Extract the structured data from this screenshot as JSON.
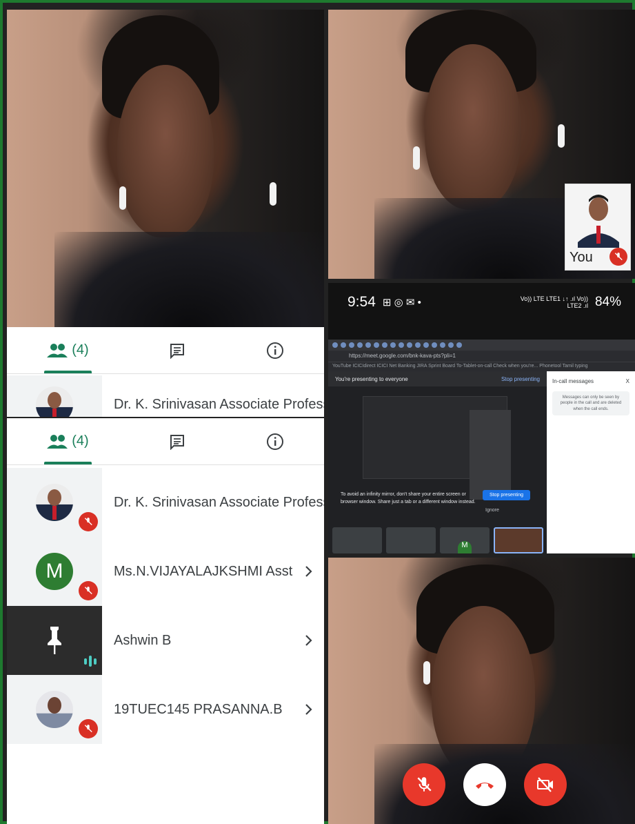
{
  "colors": {
    "frame_border": "#1e7a2f",
    "accent_green": "#1a7f5a",
    "mute_red": "#d93025",
    "control_red": "#e8382b",
    "avatar_green": "#2e7d32"
  },
  "participants_panel": {
    "people_tab_count": "(4)",
    "people_tab_icon": "people-icon",
    "chat_tab_icon": "chat-icon",
    "info_tab_icon": "info-icon"
  },
  "participants_preview": [
    {
      "name": "Dr. K. Srinivasan Associate Professo..."
    }
  ],
  "participants": [
    {
      "name": "Dr. K. Srinivasan Associate Professo...",
      "avatar": "photo",
      "muted": true
    },
    {
      "name": "Ms.N.VIJAYALAJKSHMI Asst P...",
      "avatar_letter": "M",
      "muted": true
    },
    {
      "name": "Ashwin B",
      "avatar": "pin",
      "speaking": true
    },
    {
      "name": "19TUEC145 PRASANNA.B",
      "avatar": "photo",
      "muted": true
    }
  ],
  "phone_screenshot": {
    "time": "9:54",
    "status_icons": "Vo)) LTE LTE1 ↓↑ .ıl Vo)) LTE2 .ıl",
    "battery": "84%",
    "url": "https://meet.google.com/bnk-kava-pts?pli=1",
    "bookmarks": "YouTube   ICICIdirect   ICICI Net Banking   JIRA Sprint Board   To-Tablet-on-call   Check when you're...   Phonetool   Tamil typing",
    "presenting_text": "You're presenting to everyone",
    "stop_presenting_link": "Stop presenting",
    "warning_text": "To avoid an infinity mirror, don't share your entire screen or browser window. Share just a tab or a different window instead.",
    "stop_presenting_button": "Stop presenting",
    "ignore_text": "Ignore",
    "chat_title": "In-call messages",
    "chat_close": "X",
    "chat_note": "Messages can only be seen by people in the call and are deleted when the call ends.",
    "thumb_letter": "M"
  },
  "self_tile": {
    "label": "You"
  },
  "controls": {
    "mic_icon": "mic-off-icon",
    "hangup_icon": "hang-up-icon",
    "camera_icon": "camera-off-icon"
  }
}
